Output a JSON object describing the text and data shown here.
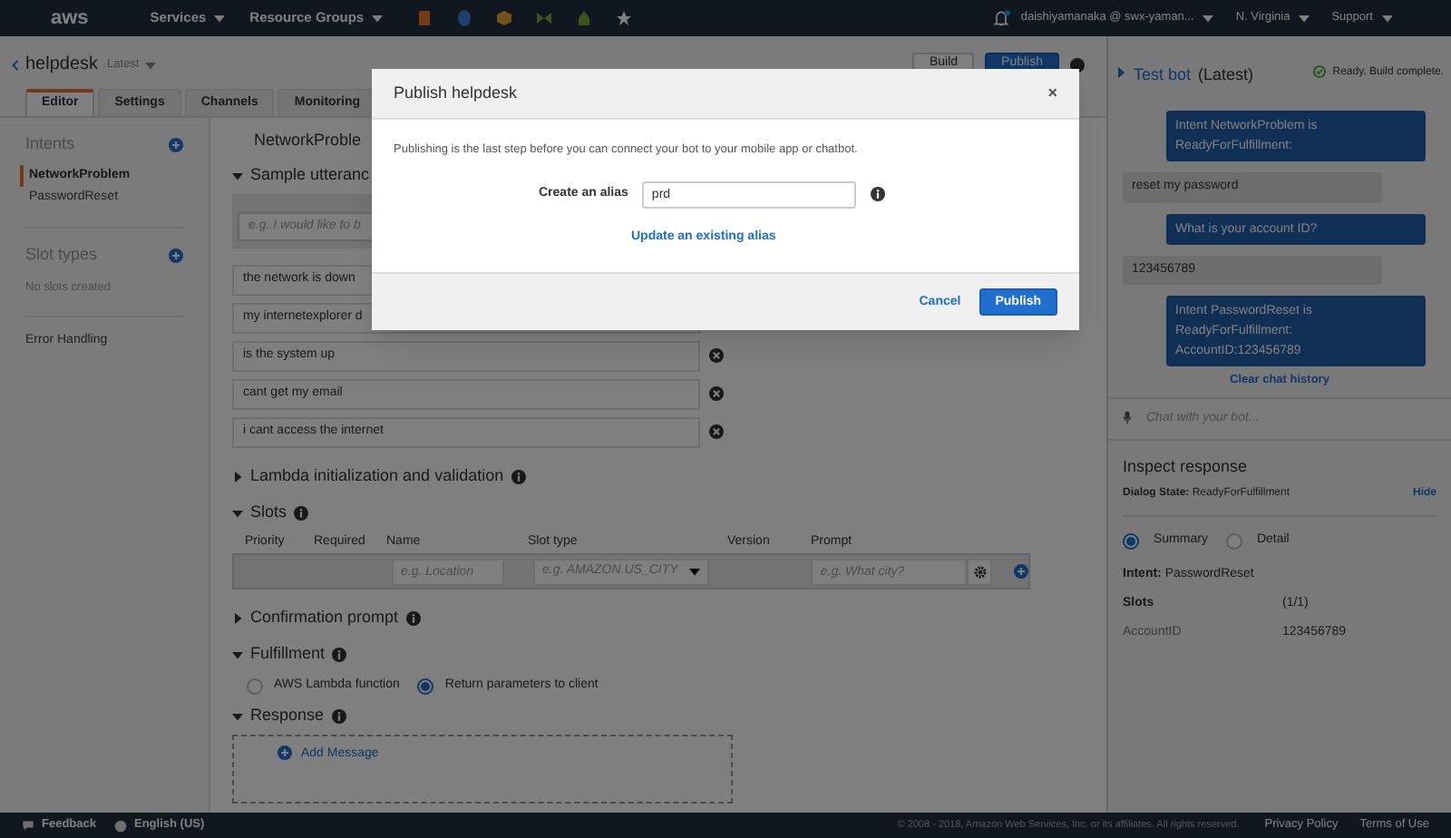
{
  "nav": {
    "logo": "aws",
    "menus": [
      {
        "label": "Services"
      },
      {
        "label": "Resource Groups"
      }
    ],
    "user": "daishiyamanaka @ swx-yaman...",
    "region": "N. Virginia",
    "support": "Support"
  },
  "bot": {
    "name": "helpdesk",
    "version": "Latest",
    "buttons": [
      "Build",
      "Publish"
    ]
  },
  "tabs": [
    {
      "label": "Editor",
      "selected": true
    },
    {
      "label": "Settings",
      "selected": false
    },
    {
      "label": "Channels",
      "selected": false
    },
    {
      "label": "Monitoring",
      "selected": false
    }
  ],
  "sidebar": {
    "intents": {
      "title": "Intents",
      "items": [
        {
          "label": "NetworkProblem",
          "selected": true
        },
        {
          "label": "PasswordReset",
          "selected": false
        }
      ]
    },
    "slot_types": {
      "title": "Slot types",
      "empty": "No slots created"
    },
    "error_handling": "Error Handling"
  },
  "intent": {
    "name": "NetworkProble",
    "sections": [
      {
        "kind": "utterances",
        "title": "Sample utteranc",
        "expanded": true,
        "info": false,
        "placeholder": "e.g. I would like to b",
        "items": [
          "the network is down",
          "my internetexplorer d",
          "is the system up",
          "cant get my email",
          "i cant access the internet"
        ]
      },
      {
        "kind": "plain",
        "title": "Lambda initialization and validation",
        "expanded": false,
        "info": true
      },
      {
        "kind": "slots",
        "title": "Slots",
        "expanded": true,
        "info": true,
        "columns": [
          "Priority",
          "Required",
          "Name",
          "Slot type",
          "Version",
          "Prompt"
        ],
        "name_placeholder": "e.g. Location",
        "type_placeholder": "e.g. AMAZON.US_CITY",
        "prompt_placeholder": "e.g. What city?"
      },
      {
        "kind": "plain",
        "title": "Confirmation prompt",
        "expanded": false,
        "info": true
      },
      {
        "kind": "fulfillment",
        "title": "Fulfillment",
        "expanded": true,
        "info": true,
        "options": [
          {
            "label": "AWS Lambda function",
            "selected": false
          },
          {
            "label": "Return parameters to client",
            "selected": true
          }
        ]
      },
      {
        "kind": "response",
        "title": "Response",
        "expanded": true,
        "info": true,
        "action": "Add Message"
      }
    ]
  },
  "test_bot": {
    "title": "Test bot",
    "version": "(Latest)",
    "status": "Ready. Build complete.",
    "messages": [
      {
        "kind": "bot",
        "text": "Intent NetworkProblem is ReadyForFulfillment:"
      },
      {
        "kind": "user",
        "text": "reset my password"
      },
      {
        "kind": "bot",
        "text": "What is your account ID?"
      },
      {
        "kind": "user",
        "text": "123456789"
      },
      {
        "kind": "bot",
        "text": "Intent PasswordReset is ReadyForFulfillment: AccountID:123456789"
      }
    ],
    "clear": "Clear chat history",
    "chat_placeholder": "Chat with your bot...",
    "inspect": {
      "title": "Inspect response",
      "dialog_label": "Dialog State:",
      "dialog_value": "ReadyForFulfillment",
      "hide": "Hide",
      "views": [
        {
          "label": "Summary",
          "selected": true
        },
        {
          "label": "Detail",
          "selected": false
        }
      ],
      "intent_label": "Intent:",
      "intent_value": "PasswordReset",
      "slots_label": "Slots",
      "slots_count": "(1/1)",
      "slots": [
        {
          "name": "AccountID",
          "value": "123456789"
        }
      ]
    }
  },
  "modal": {
    "title": "Publish helpdesk",
    "close": "×",
    "description": "Publishing is the last step before you can connect your bot to your mobile app or chatbot.",
    "alias_label": "Create an alias",
    "alias_value": "prd",
    "link": "Update an existing alias",
    "buttons": [
      "Cancel",
      "Publish"
    ]
  },
  "footer": {
    "feedback": "Feedback",
    "language": "English (US)",
    "copyright": "© 2008 - 2018, Amazon Web Services, Inc. or its affiliates. All rights reserved.",
    "links": [
      "Privacy Policy",
      "Terms of Use"
    ]
  }
}
